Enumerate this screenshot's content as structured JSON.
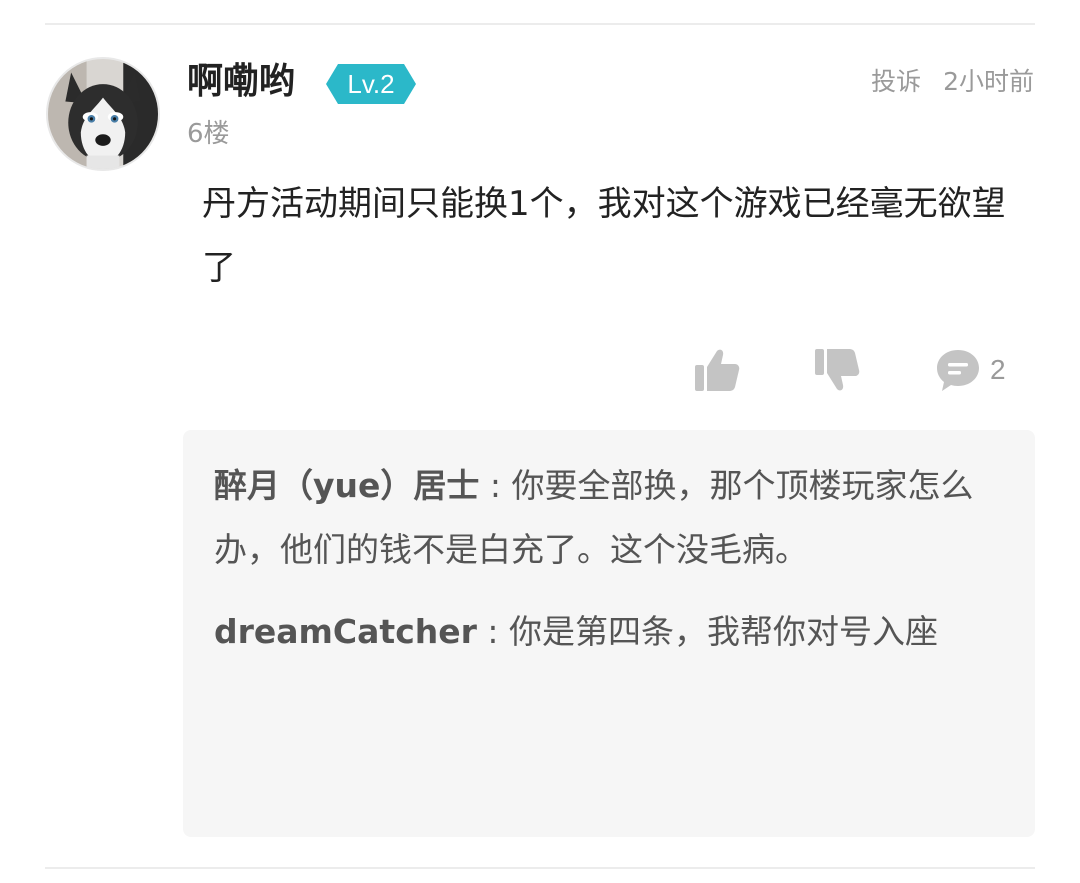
{
  "comment": {
    "username": "啊嘞哟",
    "level": "Lv.2",
    "floor": "6楼",
    "report_label": "投诉",
    "time": "2小时前",
    "content": "丹方活动期间只能换1个，我对这个游戏已经毫无欲望了",
    "actions": {
      "like_icon": "thumbs-up-icon",
      "dislike_icon": "thumbs-down-icon",
      "comment_icon": "comment-bubble-icon",
      "comment_count": "2"
    }
  },
  "replies": [
    {
      "author": "醉月（yue）居士",
      "separator": " : ",
      "text": "你要全部换，那个顶楼玩家怎么办，他们的钱不是白充了。这个没毛病。"
    },
    {
      "author": "dreamCatcher",
      "separator": " : ",
      "text": "你是第四条，我帮你对号入座"
    }
  ],
  "colors": {
    "level_badge": "#2bb8c9",
    "icon_gray": "#c4c4c4",
    "reply_background": "#f6f6f6"
  }
}
